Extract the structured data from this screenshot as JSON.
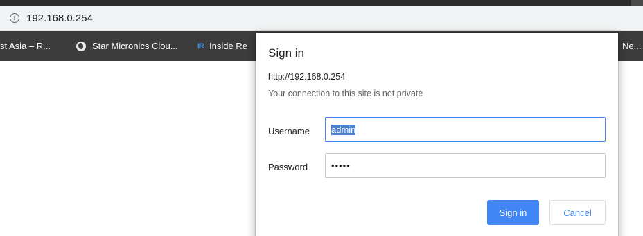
{
  "browser": {
    "url": "192.168.0.254",
    "info_icon_glyph": "i"
  },
  "bookmarks": [
    {
      "label": "st Asia – R...",
      "icon": "none"
    },
    {
      "label": "Star Micronics Clou...",
      "icon": "globe-icon"
    },
    {
      "label": "Inside Re",
      "icon": "ir-logo-icon",
      "icon_text": "IR"
    },
    {
      "label": "Ne...",
      "icon": "none"
    }
  ],
  "dialog": {
    "title": "Sign in",
    "origin": "http://192.168.0.254",
    "warning": "Your connection to this site is not private",
    "username_label": "Username",
    "username_value": "admin",
    "password_label": "Password",
    "password_value": "admin",
    "sign_in_label": "Sign in",
    "cancel_label": "Cancel"
  },
  "colors": {
    "accent": "#4285f4",
    "bookmarks_bar": "#3c3c3c",
    "address_bar": "#f1f3f4"
  }
}
